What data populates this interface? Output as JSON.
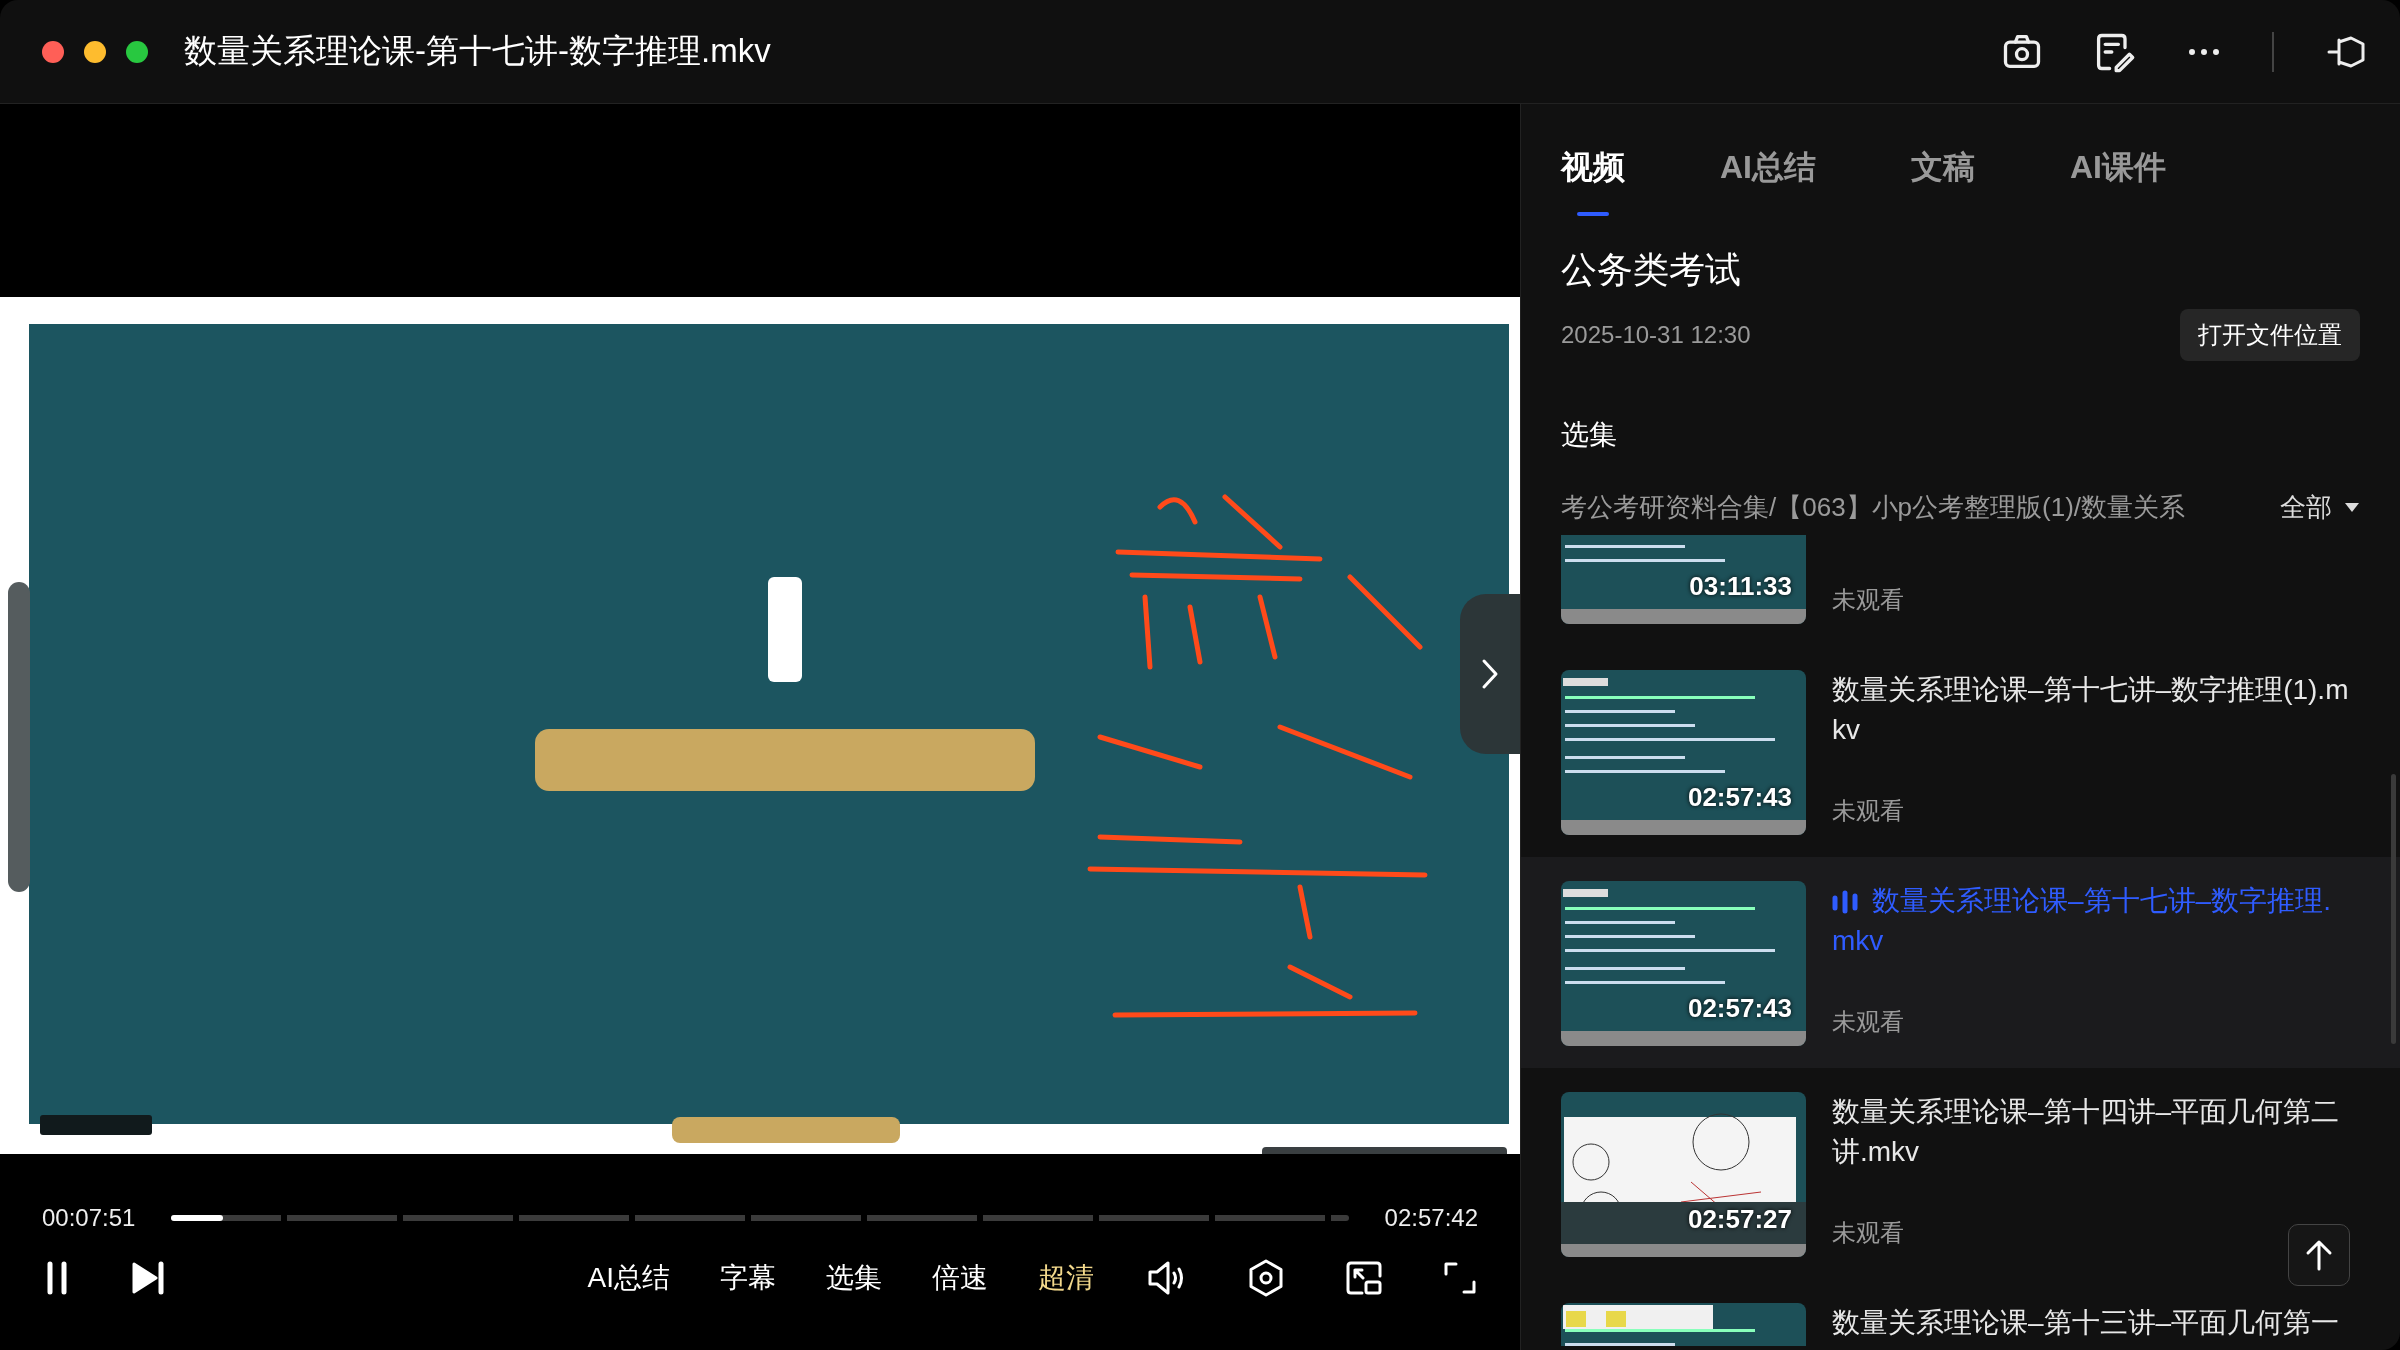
{
  "window": {
    "title": "数量关系理论课-第十七讲-数字推理.mkv"
  },
  "player": {
    "current_time": "00:07:51",
    "total_time": "02:57:42",
    "progress": {
      "level": 0.044
    },
    "playing": true,
    "controls": [
      {
        "label": "AI总结",
        "selected": false
      },
      {
        "label": "字幕",
        "selected": false
      },
      {
        "label": "选集",
        "selected": false
      },
      {
        "label": "倍速",
        "selected": false
      },
      {
        "label": "超清",
        "selected": true
      }
    ]
  },
  "tabs": [
    {
      "label": "视频",
      "selected": true
    },
    {
      "label": "AI总结",
      "selected": false
    },
    {
      "label": "文稿",
      "selected": false
    },
    {
      "label": "AI课件",
      "selected": false
    }
  ],
  "collection": {
    "title": "公务类考试",
    "date": "2025-10-31 12:30",
    "open_button": "打开文件位置",
    "section": "选集",
    "path": "考公考研资料合集/【063】小p公考整理版(1)/数量关系",
    "filter": "全部"
  },
  "episodes": [
    {
      "duration": "03:11:33",
      "status": "未观看",
      "selected": false
    },
    {
      "title": "数量关系理论课–第十七讲–数字推理(1).mkv",
      "duration": "02:57:43",
      "status": "未观看",
      "selected": false
    },
    {
      "title": "数量关系理论课–第十七讲–数字推理.mkv",
      "duration": "02:57:43",
      "status": "未观看",
      "selected": true
    },
    {
      "title": "数量关系理论课–第十四讲–平面几何第二讲.mkv",
      "duration": "02:57:27",
      "status": "未观看",
      "selected": false
    },
    {
      "title": "数量关系理论课–第十三讲–平面几何第一",
      "selected": false
    }
  ]
}
